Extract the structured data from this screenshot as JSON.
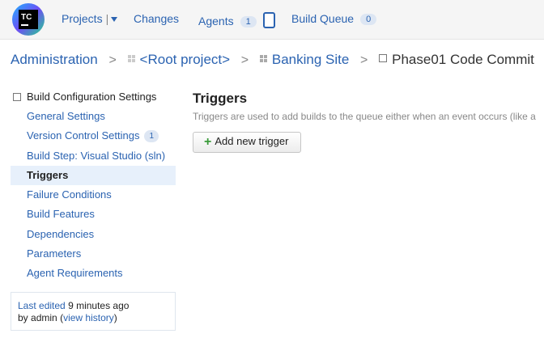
{
  "topnav": {
    "logo_text": "TC",
    "projects_label": "Projects",
    "projects_sep": "|",
    "changes_label": "Changes",
    "agents_label": "Agents",
    "agents_count": "1",
    "build_queue_label": "Build Queue",
    "build_queue_count": "0"
  },
  "breadcrumb": {
    "sep": ">",
    "items": [
      "Administration",
      "<Root project>",
      "Banking Site",
      "Phase01 Code Commit"
    ]
  },
  "sidebar": {
    "header": "Build Configuration Settings",
    "items": [
      {
        "label": "General Settings"
      },
      {
        "label": "Version Control Settings",
        "badge": "1"
      },
      {
        "label": "Build Step: Visual Studio (sln)"
      },
      {
        "label": "Triggers"
      },
      {
        "label": "Failure Conditions"
      },
      {
        "label": "Build Features"
      },
      {
        "label": "Dependencies"
      },
      {
        "label": "Parameters"
      },
      {
        "label": "Agent Requirements"
      }
    ],
    "active_index": 3
  },
  "last_edit": {
    "link_text": "Last edited",
    "time_text": "9 minutes ago",
    "by_prefix": "by",
    "user": "admin",
    "history_open": "(",
    "history_link": "view history",
    "history_close": ")"
  },
  "main": {
    "title": "Triggers",
    "description": "Triggers are used to add builds to the queue either when an event occurs (like a",
    "add_button_label": "Add new trigger"
  },
  "colors": {
    "link": "#2b63b1",
    "active_bg": "#e7f0fb",
    "plus": "#3a9b3a"
  }
}
